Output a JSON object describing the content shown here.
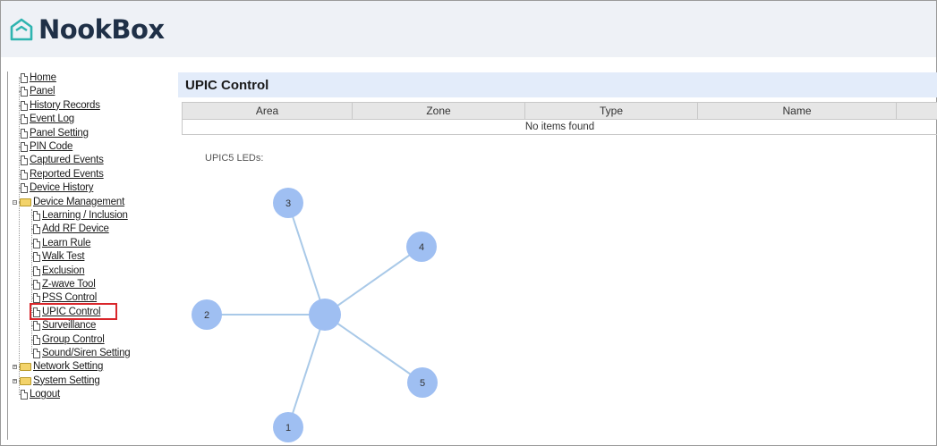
{
  "app": {
    "logo_text": "NookBox"
  },
  "sidebar": {
    "items": [
      {
        "label": "Home"
      },
      {
        "label": "Panel"
      },
      {
        "label": "History Records"
      },
      {
        "label": "Event Log"
      },
      {
        "label": "Panel Setting"
      },
      {
        "label": "PIN Code"
      },
      {
        "label": "Captured Events"
      },
      {
        "label": "Reported Events"
      },
      {
        "label": "Device History"
      },
      {
        "label": "Device Management"
      },
      {
        "label": "Learning / Inclusion"
      },
      {
        "label": "Add RF Device"
      },
      {
        "label": "Learn Rule"
      },
      {
        "label": "Walk Test"
      },
      {
        "label": "Exclusion"
      },
      {
        "label": "Z-wave Tool"
      },
      {
        "label": "PSS Control"
      },
      {
        "label": "UPIC Control"
      },
      {
        "label": "Surveillance"
      },
      {
        "label": "Group Control"
      },
      {
        "label": "Sound/Siren Setting"
      },
      {
        "label": "Network Setting"
      },
      {
        "label": "System Setting"
      },
      {
        "label": "Logout"
      }
    ],
    "selected": "UPIC Control",
    "highlight_color": "#d9262b"
  },
  "main": {
    "title": "UPIC Control",
    "table": {
      "columns": [
        "Area",
        "Zone",
        "Type",
        "Name"
      ],
      "empty_text": "No items found"
    },
    "led_label": "UPIC5 LEDs:",
    "leds": [
      {
        "label": "1"
      },
      {
        "label": "2"
      },
      {
        "label": "3"
      },
      {
        "label": "4"
      },
      {
        "label": "5"
      }
    ],
    "led_color": "#9fbff2",
    "line_color": "#a9c9e8"
  }
}
